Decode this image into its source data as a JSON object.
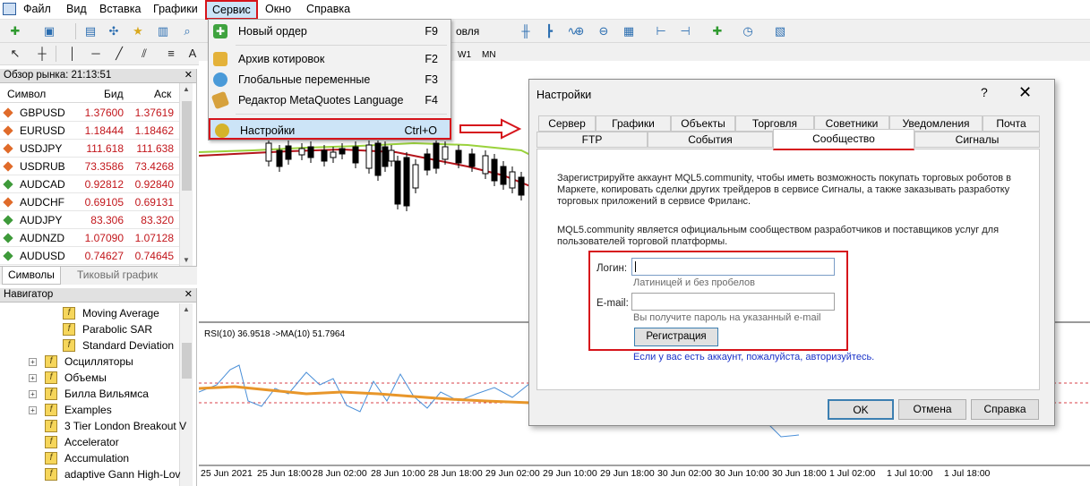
{
  "menubar": {
    "items": [
      "Файл",
      "Вид",
      "Вставка",
      "Графики",
      "Сервис",
      "Окно",
      "Справка"
    ]
  },
  "toolbar": {
    "timeframe_partial": "овля",
    "w1": "W1",
    "mn": "MN"
  },
  "market_watch": {
    "title": "Обзор рынка: 21:13:51",
    "columns": [
      "Символ",
      "Бид",
      "Аск"
    ],
    "rows": [
      {
        "symbol": "GBPUSD",
        "bid": "1.37600",
        "ask": "1.37619",
        "dir": "down"
      },
      {
        "symbol": "EURUSD",
        "bid": "1.18444",
        "ask": "1.18462",
        "dir": "down"
      },
      {
        "symbol": "USDJPY",
        "bid": "111.618",
        "ask": "111.638",
        "dir": "down"
      },
      {
        "symbol": "USDRUB",
        "bid": "73.3586",
        "ask": "73.4268",
        "dir": "down"
      },
      {
        "symbol": "AUDCAD",
        "bid": "0.92812",
        "ask": "0.92840",
        "dir": "up"
      },
      {
        "symbol": "AUDCHF",
        "bid": "0.69105",
        "ask": "0.69131",
        "dir": "down"
      },
      {
        "symbol": "AUDJPY",
        "bid": "83.306",
        "ask": "83.320",
        "dir": "up"
      },
      {
        "symbol": "AUDNZD",
        "bid": "1.07090",
        "ask": "1.07128",
        "dir": "up"
      },
      {
        "symbol": "AUDUSD",
        "bid": "0.74627",
        "ask": "0.74645",
        "dir": "up"
      }
    ],
    "tabs": [
      "Символы",
      "Тиковый график"
    ]
  },
  "navigator": {
    "title": "Навигатор",
    "items": [
      "Moving Average",
      "Parabolic SAR",
      "Standard Deviation",
      "Осцилляторы",
      "Объемы",
      "Билла Вильямса",
      "Examples",
      "3 Tier London Breakout V",
      "Accelerator",
      "Accumulation",
      "adaptive Gann High-Lov"
    ]
  },
  "menu": {
    "items": [
      {
        "label": "Новый ордер",
        "shortcut": "F9"
      },
      {
        "label": "Архив котировок",
        "shortcut": "F2"
      },
      {
        "label": "Глобальные переменные",
        "shortcut": "F3"
      },
      {
        "label": "Редактор MetaQuotes Language",
        "shortcut": "F4"
      },
      {
        "label": "Настройки",
        "shortcut": "Ctrl+O"
      }
    ]
  },
  "chart": {
    "rsi_label": "RSI(10) 36.9518  ->MA(10) 51.7964",
    "x_labels": [
      "25 Jun 2021",
      "25 Jun 18:00",
      "28 Jun 02:00",
      "28 Jun 10:00",
      "28 Jun 18:00",
      "29 Jun 02:00",
      "29 Jun 10:00",
      "29 Jun 18:00",
      "30 Jun 02:00",
      "30 Jun 10:00",
      "30 Jun 18:00",
      "1 Jul 02:00",
      "1 Jul 10:00",
      "1 Jul 18:00"
    ]
  },
  "dialog": {
    "title": "Настройки",
    "help": "?",
    "close": "✕",
    "tabs_row1": [
      "Сервер",
      "Графики",
      "Объекты",
      "Торговля",
      "Советники",
      "Уведомления",
      "Почта"
    ],
    "tabs_row2": [
      "FTP",
      "События",
      "Сообщество",
      "Сигналы"
    ],
    "text1": "Зарегистрируйте аккаунт MQL5.community, чтобы иметь возможность покупать торговых роботов в Маркете, копировать сделки других трейдеров в сервисе Сигналы, а также заказывать разработку торговых приложений в сервисе Фриланс.",
    "text2": "MQL5.community является официальным сообществом разработчиков и поставщиков услуг для пользователей торговой платформы.",
    "login_label": "Логин:",
    "login_hint": "Латиницей и без пробелов",
    "email_label": "E-mail:",
    "email_hint": "Вы получите пароль на указанный e-mail",
    "register": "Регистрация",
    "link": "Если у вас есть аккаунт, пожалуйста, авторизуйтесь.",
    "ok": "OK",
    "cancel": "Отмена",
    "helpbtn": "Справка"
  },
  "colors": {
    "highlight": "#d6141b",
    "bid": "#c2161b",
    "ma_green": "#9ad23c",
    "ma_red": "#b4141b",
    "rsi_blue": "#4a8fd8",
    "rsi_orange": "#e8962a"
  }
}
